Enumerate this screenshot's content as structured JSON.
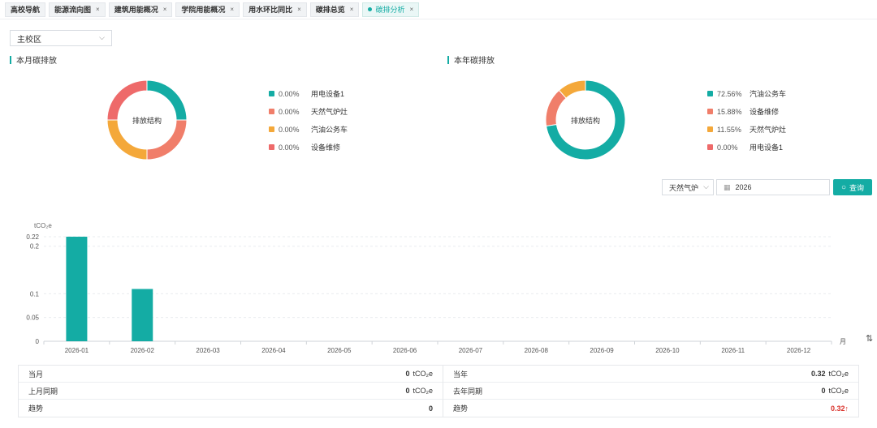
{
  "tabs": [
    {
      "label": "高校导航",
      "closable": false,
      "active": false
    },
    {
      "label": "能源流向图",
      "closable": true,
      "active": false
    },
    {
      "label": "建筑用能概况",
      "closable": true,
      "active": false
    },
    {
      "label": "学院用能概况",
      "closable": true,
      "active": false
    },
    {
      "label": "用水环比同比",
      "closable": true,
      "active": false
    },
    {
      "label": "碳排总览",
      "closable": true,
      "active": false
    },
    {
      "label": "碳排分析",
      "closable": true,
      "active": true
    }
  ],
  "close_glyph": "×",
  "campus": {
    "value": "主校区",
    "chev": "⌵"
  },
  "monthly": {
    "title": "本月碳排放",
    "center_label": "排放结构",
    "legend": [
      {
        "pct": "0.00%",
        "name": "用电设备1",
        "color": "#14aca4"
      },
      {
        "pct": "0.00%",
        "name": "天然气炉灶",
        "color": "#f07e6a"
      },
      {
        "pct": "0.00%",
        "name": "汽油公务车",
        "color": "#f4a83a"
      },
      {
        "pct": "0.00%",
        "name": "设备维修",
        "color": "#ee6a6a"
      }
    ]
  },
  "yearly": {
    "title": "本年碳排放",
    "center_label": "排放结构",
    "legend": [
      {
        "pct": "72.56%",
        "name": "汽油公务车",
        "color": "#14aca4"
      },
      {
        "pct": "15.88%",
        "name": "设备维修",
        "color": "#f07e6a"
      },
      {
        "pct": "11.55%",
        "name": "天然气炉灶",
        "color": "#f4a83a"
      },
      {
        "pct": "0.00%",
        "name": "用电设备1",
        "color": "#ee6a6a"
      }
    ]
  },
  "filters": {
    "energy_value": "天然气炉",
    "chev": "⌵",
    "year_value": "2026",
    "query_label": "查询",
    "cal_icon": "▦",
    "search_icon": "○"
  },
  "chart_data": {
    "type": "bar",
    "ylabel": "tCO₂e",
    "xlabel": "月",
    "categories": [
      "2026-01",
      "2026-02",
      "2026-03",
      "2026-04",
      "2026-05",
      "2026-06",
      "2026-07",
      "2026-08",
      "2026-09",
      "2026-10",
      "2026-11",
      "2026-12"
    ],
    "values": [
      0.22,
      0.11,
      0,
      0,
      0,
      0,
      0,
      0,
      0,
      0,
      0,
      0
    ],
    "yticks": [
      0,
      0.05,
      0.1,
      0.2,
      0.22
    ],
    "ytick_labels": [
      "0",
      "0.05",
      "0.1",
      "0.2",
      "0.22"
    ],
    "ylim": [
      0,
      0.22
    ],
    "color": "#14aca4",
    "grid": true
  },
  "side_icon": "⇅",
  "summary": {
    "left": [
      {
        "label": "当月",
        "value": "0",
        "unit": "tCO₂e"
      },
      {
        "label": "上月同期",
        "value": "0",
        "unit": "tCO₂e"
      },
      {
        "label": "趋势",
        "value": "0",
        "unit": ""
      }
    ],
    "right": [
      {
        "label": "当年",
        "value": "0.32",
        "unit": "tCO₂e"
      },
      {
        "label": "去年同期",
        "value": "0",
        "unit": "tCO₂e"
      },
      {
        "label": "趋势",
        "value": "0.32↑",
        "unit": ""
      }
    ]
  }
}
